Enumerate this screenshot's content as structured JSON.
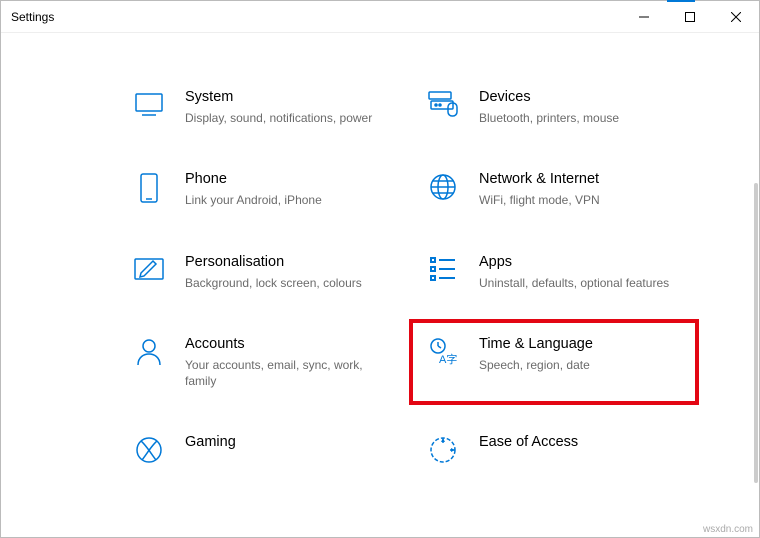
{
  "window": {
    "title": "Settings"
  },
  "tiles": {
    "system": {
      "title": "System",
      "desc": "Display, sound, notifications, power"
    },
    "devices": {
      "title": "Devices",
      "desc": "Bluetooth, printers, mouse"
    },
    "phone": {
      "title": "Phone",
      "desc": "Link your Android, iPhone"
    },
    "network": {
      "title": "Network & Internet",
      "desc": "WiFi, flight mode, VPN"
    },
    "personal": {
      "title": "Personalisation",
      "desc": "Background, lock screen, colours"
    },
    "apps": {
      "title": "Apps",
      "desc": "Uninstall, defaults, optional features"
    },
    "accounts": {
      "title": "Accounts",
      "desc": "Your accounts, email, sync, work, family"
    },
    "time_language": {
      "title": "Time & Language",
      "desc": "Speech, region, date"
    },
    "gaming": {
      "title": "Gaming",
      "desc": ""
    },
    "ease": {
      "title": "Ease of Access",
      "desc": ""
    }
  },
  "watermark": "wsxdn.com"
}
